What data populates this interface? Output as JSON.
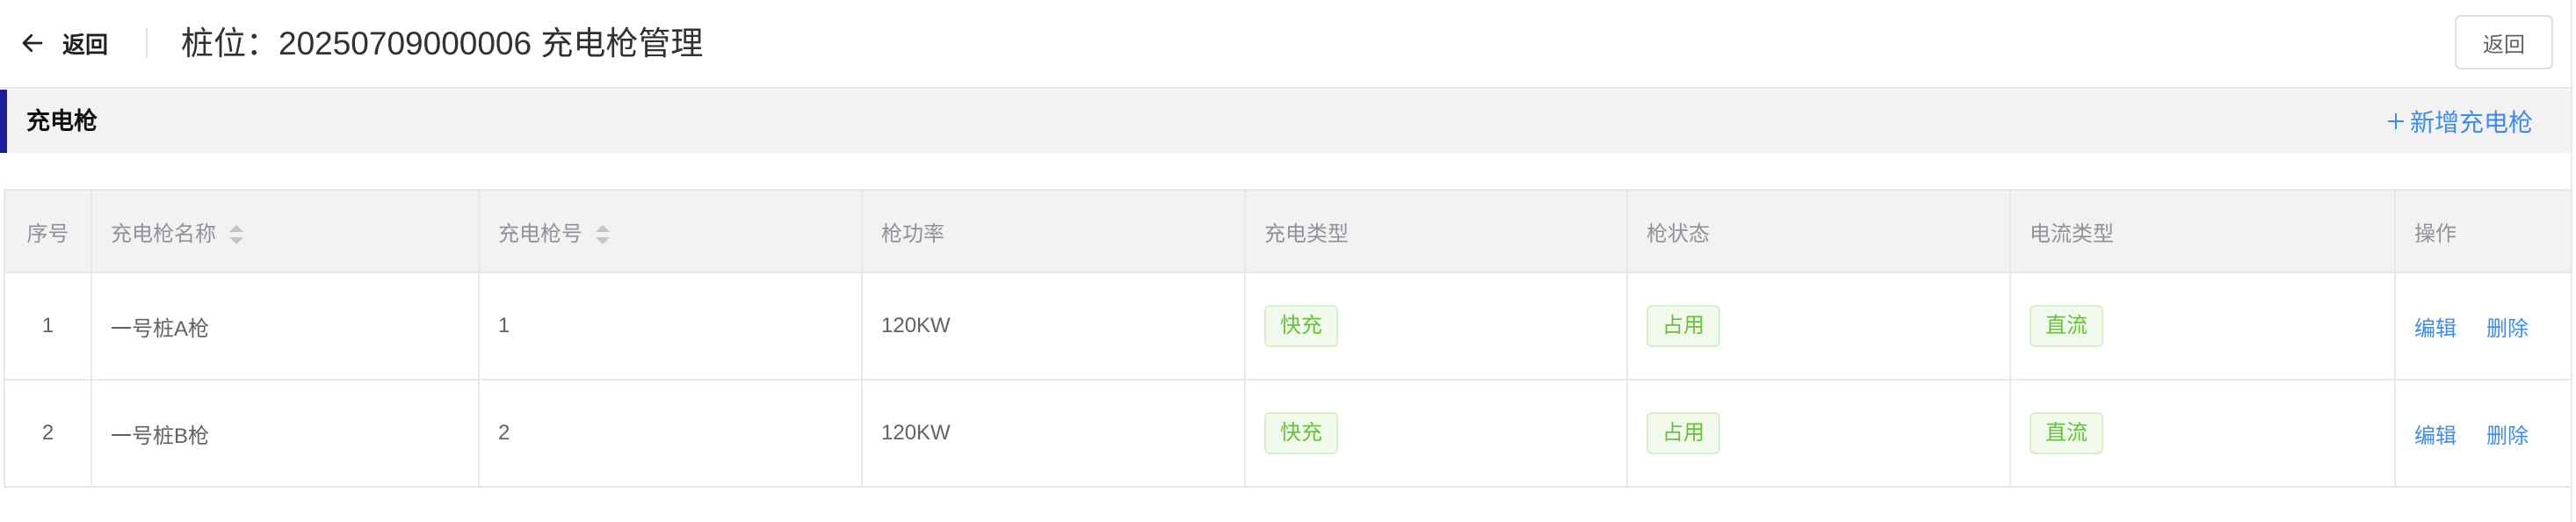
{
  "header": {
    "back_icon": "arrow-left-icon",
    "back_label": "返回",
    "title": "桩位：20250709000006 充电枪管理",
    "return_button_label": "返回"
  },
  "section": {
    "title": "充电枪",
    "add_icon": "plus-icon",
    "add_label": "新增充电枪"
  },
  "table": {
    "sort_icon": "sort-caret-icon",
    "columns": [
      "序号",
      "充电枪名称",
      "充电枪号",
      "枪功率",
      "充电类型",
      "枪状态",
      "电流类型",
      "操作"
    ],
    "rows": [
      {
        "index": "1",
        "name": "一号桩A枪",
        "gun_no": "1",
        "power": "120KW",
        "charge_type": "快充",
        "status": "占用",
        "current_type": "直流",
        "edit_label": "编辑",
        "delete_label": "删除"
      },
      {
        "index": "2",
        "name": "一号桩B枪",
        "gun_no": "2",
        "power": "120KW",
        "charge_type": "快充",
        "status": "占用",
        "current_type": "直流",
        "edit_label": "编辑",
        "delete_label": "删除"
      }
    ]
  },
  "colors": {
    "accent": "#1c1c9e",
    "link": "#3c8cf0",
    "tag-text": "#67c23a",
    "tag-bg": "#f0f9eb",
    "tag-border": "#d7efc9",
    "section-bg": "#f2f2f2",
    "thead-bg": "#f2f2f2",
    "border": "#e6e8ee"
  }
}
